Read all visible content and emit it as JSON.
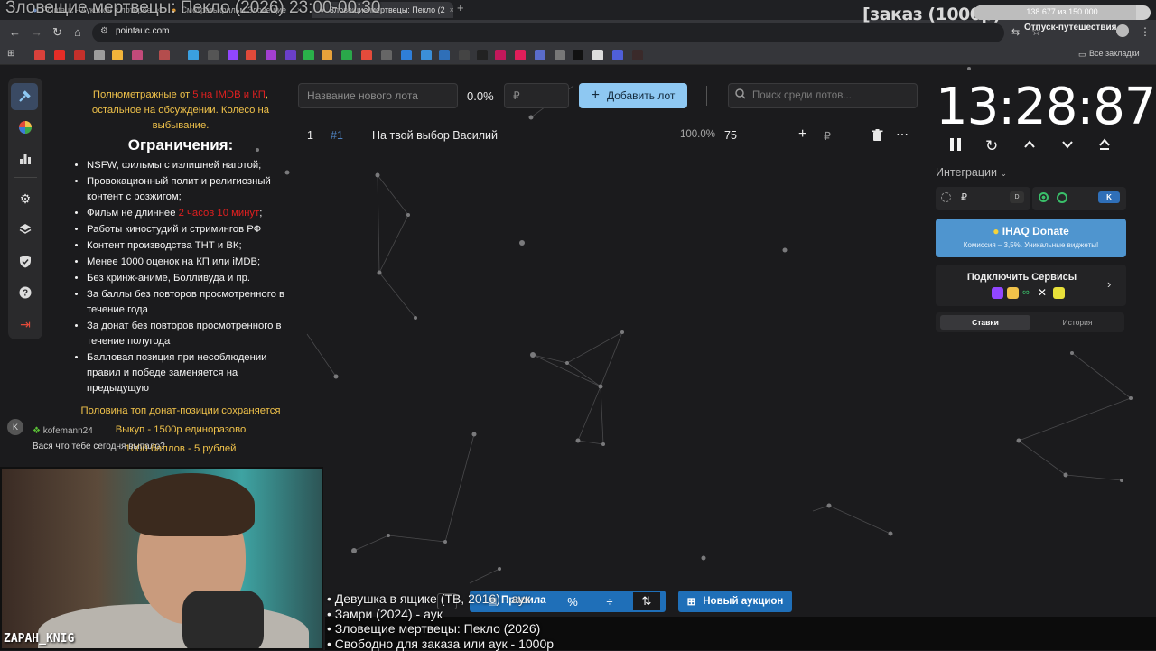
{
  "browser": {
    "tabs": [
      {
        "label": "Pointauc - Аукцион с лотерее"
      },
      {
        "label": "Смотреть фильм Зловещие"
      },
      {
        "label": "Зловещие мертвецы: Пекло (2"
      }
    ],
    "url": "pointauc.com",
    "all_bookmarks": "Все закладки"
  },
  "stream_overlay": {
    "now_playing": "Зловещие мертвецы: Пекло (2026) 23:00-00:30",
    "order_label": "[заказ (1000р)",
    "goal_text": "138 677 из 150 000",
    "goal_fraction": 0.92,
    "goal_title": "Отпуск-путешествия",
    "cam_name": "ZAPAH_KNIG",
    "film_list": [
      "• Девушка в ящике (ТВ, 2016) - аук",
      "• Замри (2024) - аук",
      "• Зловещие мертвецы: Пекло (2026)",
      "• Свободно для заказа или аук - 1000р"
    ]
  },
  "rules": {
    "intro_1": "Полнометражные от ",
    "intro_red": "5 на IMDB и КП",
    "intro_2": ", остальное на обсуждении. Колесо на выбывание.",
    "heading": "Ограничения:",
    "items": [
      "NSFW, фильмы с излишней наготой;",
      "Провокационный полит и религиозный контент с розжигом;",
      "Фильм не длиннее ",
      "Работы киностудий и стримингов РФ",
      "Контент производства ТНТ и ВК;",
      "Менее 1000 оценок на КП или iMDB;",
      "Без кринж-аниме, Болливуда и пр.",
      "За баллы без повторов просмотренного в течение года",
      "За донат без повторов просмотренного в течение полугода",
      "Балловая позиция при несоблюдении правил и победе заменяется на предыдущую"
    ],
    "length_red": "2 часов 10 минут",
    "footer_1": "Половина топ донат-позиции сохраняется",
    "footer_2": "Выкуп - 1500р единоразово",
    "footer_3": "1000 баллов - 5 рублей"
  },
  "chat": {
    "avatar_letter": "K",
    "username": "kofemann24",
    "message": "Вася что тебе сегодня выпало?"
  },
  "toolbar": {
    "lot_name_placeholder": "Название нового лота",
    "percent": "0.0%",
    "amount_placeholder": "₽",
    "add_lot": "Добавить лот",
    "search_placeholder": "Поиск среди лотов..."
  },
  "lots": [
    {
      "index": "1",
      "id": "#1",
      "name": "На твой выбор Василий",
      "percent": "100.0%",
      "amount": "75",
      "currency": "₽"
    }
  ],
  "timer": {
    "value": "13:28:87"
  },
  "integrations": {
    "label": "Интеграции",
    "currency": "₽"
  },
  "donate": {
    "title": "IHAQ Donate",
    "subtitle": "Комиссия – 3,5%. Уникальные виджеты!"
  },
  "services": {
    "title": "Подключить Сервисы"
  },
  "panel_tabs": {
    "bets": "Ставки",
    "history": "История"
  },
  "bottom": {
    "rules": "Правила",
    "new_auction": "Новый аукцион"
  }
}
